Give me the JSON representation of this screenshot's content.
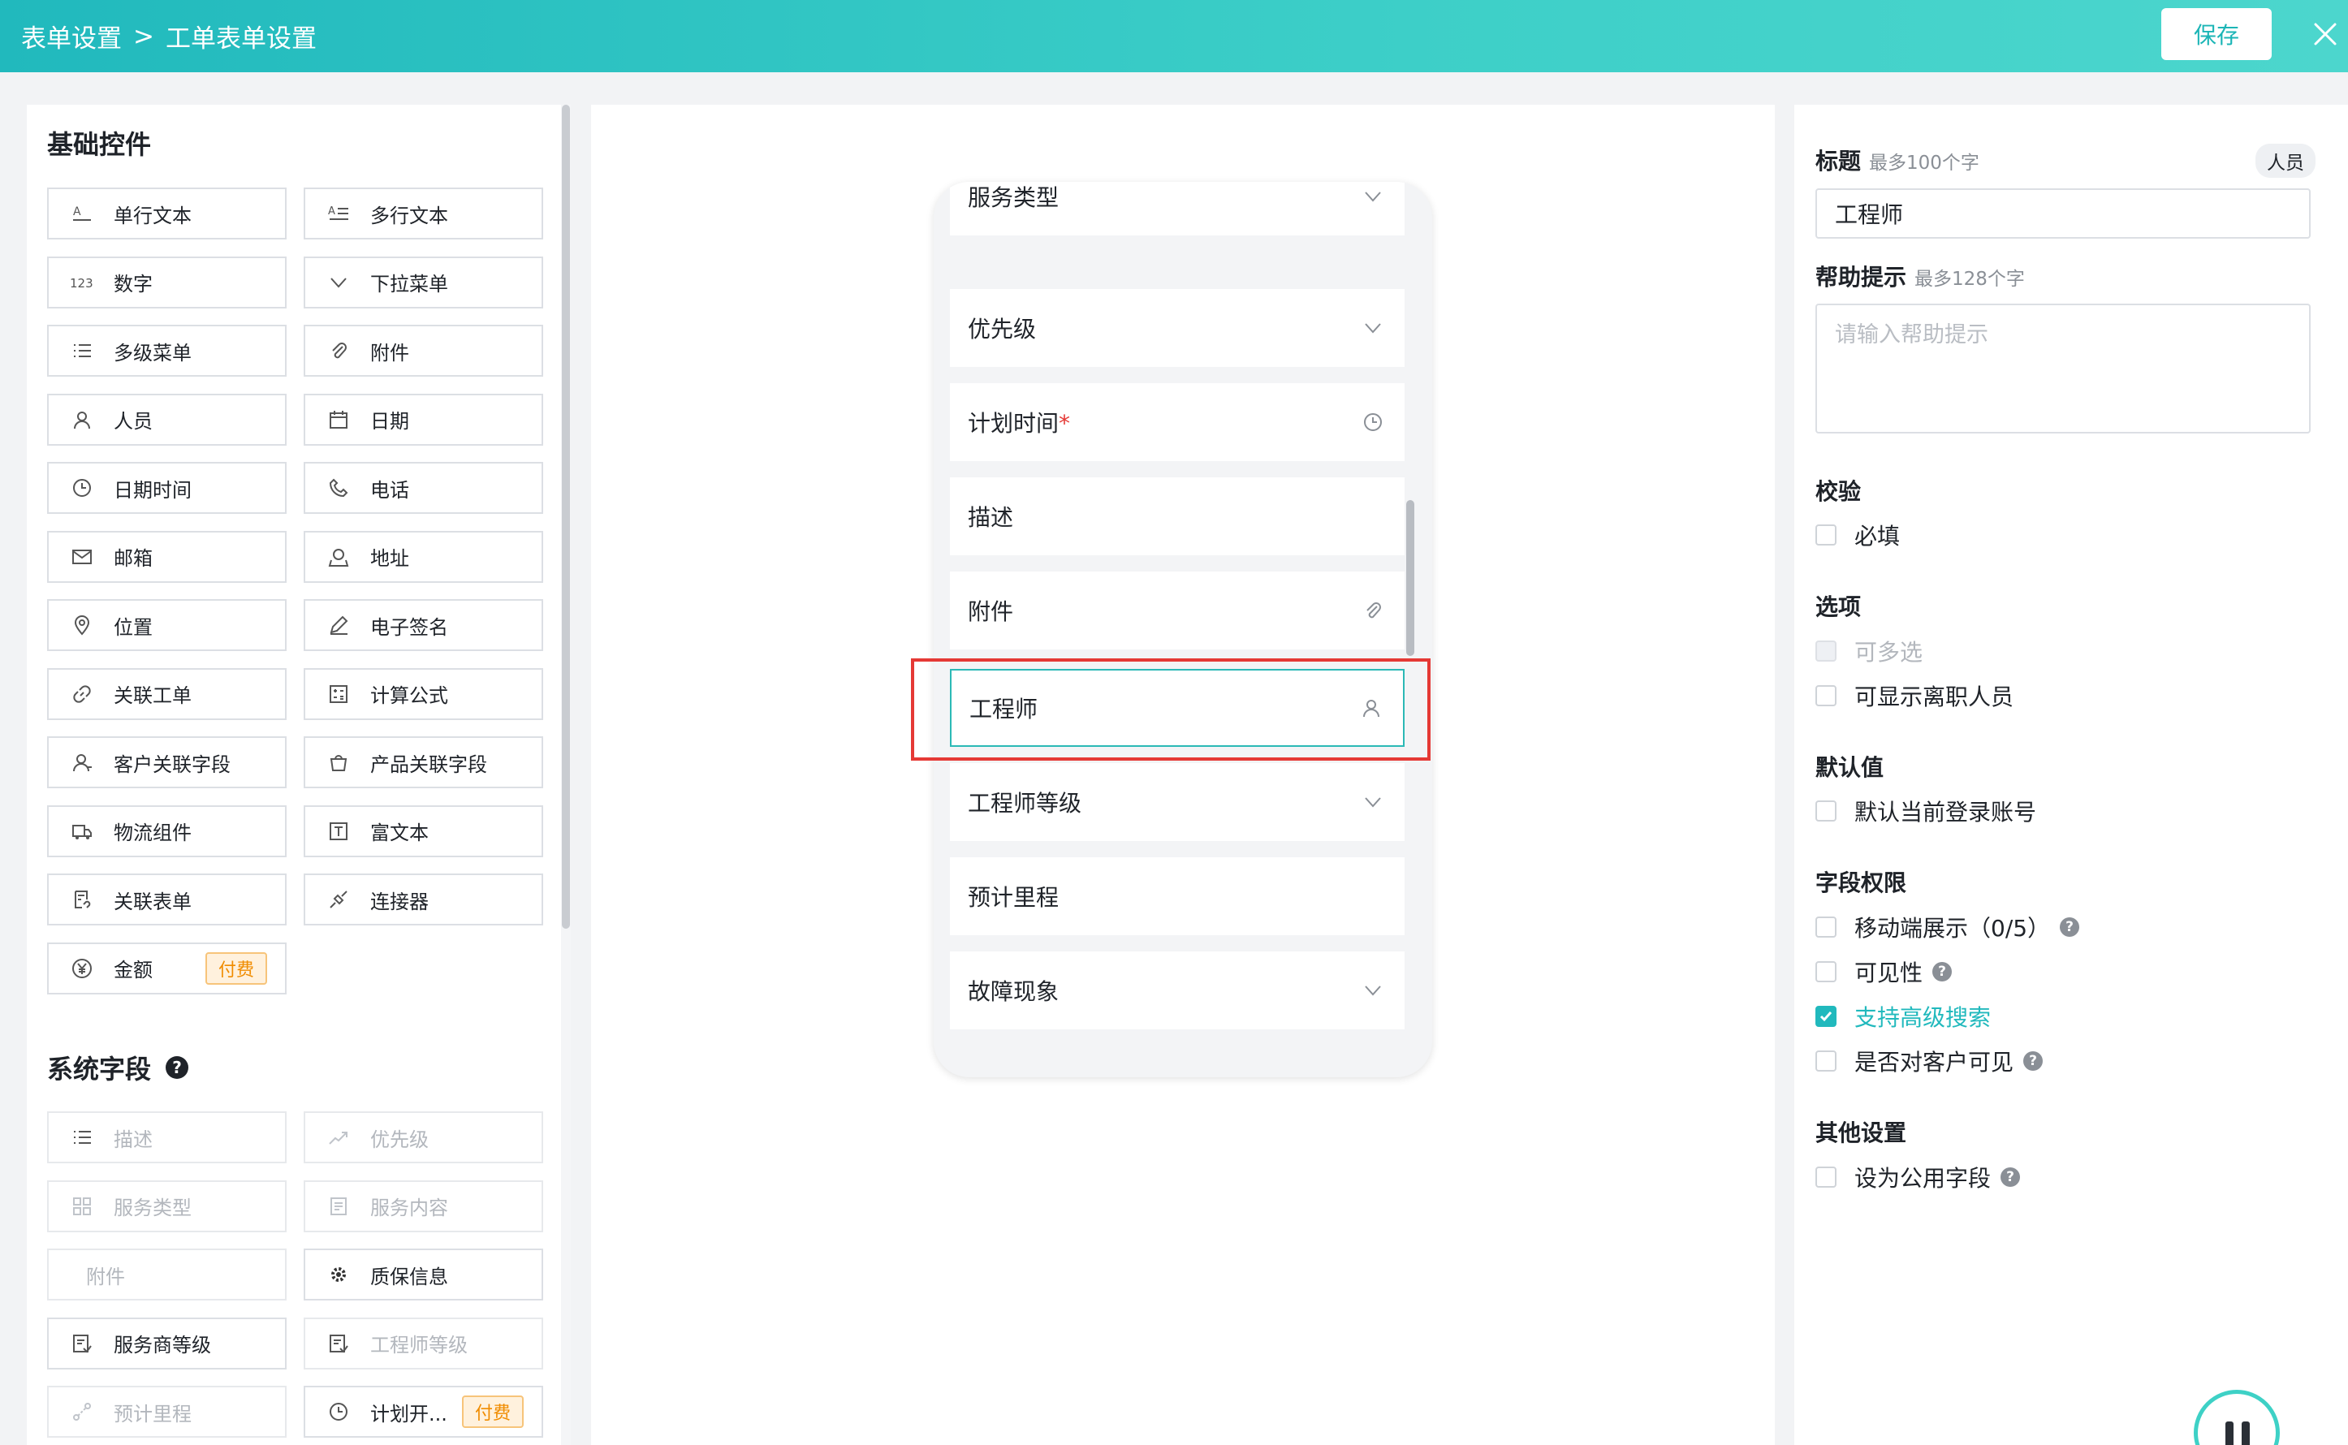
{
  "header": {
    "crumb_root": "表单设置",
    "crumb_sep": ">",
    "crumb_current": "工单表单设置",
    "save_label": "保存"
  },
  "left": {
    "basic_title": "基础控件",
    "basic_controls": [
      {
        "label": "单行文本",
        "icon": "single-line-text-icon"
      },
      {
        "label": "多行文本",
        "icon": "multi-line-text-icon"
      },
      {
        "label": "数字",
        "icon": "number-icon"
      },
      {
        "label": "下拉菜单",
        "icon": "chevron-down-icon"
      },
      {
        "label": "多级菜单",
        "icon": "list-icon"
      },
      {
        "label": "附件",
        "icon": "paperclip-icon"
      },
      {
        "label": "人员",
        "icon": "user-icon"
      },
      {
        "label": "日期",
        "icon": "calendar-icon"
      },
      {
        "label": "日期时间",
        "icon": "clock-icon"
      },
      {
        "label": "电话",
        "icon": "phone-icon"
      },
      {
        "label": "邮箱",
        "icon": "mail-icon"
      },
      {
        "label": "地址",
        "icon": "map-icon"
      },
      {
        "label": "位置",
        "icon": "location-icon"
      },
      {
        "label": "电子签名",
        "icon": "pen-icon"
      },
      {
        "label": "关联工单",
        "icon": "link-icon"
      },
      {
        "label": "计算公式",
        "icon": "calculator-icon"
      },
      {
        "label": "客户关联字段",
        "icon": "customer-icon"
      },
      {
        "label": "产品关联字段",
        "icon": "product-icon"
      },
      {
        "label": "物流组件",
        "icon": "truck-icon"
      },
      {
        "label": "富文本",
        "icon": "rich-text-icon"
      },
      {
        "label": "关联表单",
        "icon": "form-link-icon"
      },
      {
        "label": "连接器",
        "icon": "connector-icon"
      },
      {
        "label": "金额",
        "icon": "yen-icon",
        "paid": "付费"
      }
    ],
    "system_title": "系统字段",
    "system_help": "?",
    "system_fields": [
      {
        "label": "描述",
        "icon": "list-icon",
        "disabled": true
      },
      {
        "label": "优先级",
        "icon": "trend-icon",
        "disabled": true
      },
      {
        "label": "服务类型",
        "icon": "grid-icon",
        "disabled": true
      },
      {
        "label": "服务内容",
        "icon": "document-icon",
        "disabled": true
      },
      {
        "label": "附件",
        "icon": "",
        "disabled": true
      },
      {
        "label": "质保信息",
        "icon": "gear-icon",
        "disabled": false
      },
      {
        "label": "服务商等级",
        "icon": "level-icon",
        "disabled": false
      },
      {
        "label": "工程师等级",
        "icon": "level-icon",
        "disabled": true
      },
      {
        "label": "预计里程",
        "icon": "route-icon",
        "disabled": true
      },
      {
        "label": "计划开...",
        "icon": "clock-icon",
        "disabled": false,
        "paid": "付费"
      }
    ]
  },
  "phone": {
    "fields": [
      {
        "label": "服务类型",
        "icon": "chevron-down-icon"
      },
      {
        "label": "优先级",
        "icon": "chevron-down-icon"
      },
      {
        "label": "计划时间",
        "required": "*",
        "icon": "clock-icon"
      },
      {
        "label": "描述",
        "icon": ""
      },
      {
        "label": "附件",
        "icon": "paperclip-icon"
      },
      {
        "label": "工程师",
        "icon": "user-icon",
        "active": true
      },
      {
        "label": "工程师等级",
        "icon": "chevron-down-icon"
      },
      {
        "label": "预计里程",
        "icon": ""
      },
      {
        "label": "故障现象",
        "icon": "chevron-down-icon"
      }
    ]
  },
  "right": {
    "title_label": "标题",
    "title_hint": "最多100个字",
    "type_tag": "人员",
    "title_value": "工程师",
    "help_label": "帮助提示",
    "help_hint": "最多128个字",
    "help_placeholder": "请输入帮助提示",
    "validate_label": "校验",
    "required_label": "必填",
    "options_label": "选项",
    "multi_label": "可多选",
    "resigned_label": "可显示离职人员",
    "default_label": "默认值",
    "default_current_label": "默认当前登录账号",
    "permission_label": "字段权限",
    "mobile_display_label": "移动端展示（0/5）",
    "visibility_label": "可见性",
    "advanced_search_label": "支持高级搜索",
    "customer_visible_label": "是否对客户可见",
    "other_label": "其他设置",
    "public_field_label": "设为公用字段"
  },
  "colors": {
    "accent": "#21b9bd",
    "highlight": "#e53935",
    "paid": "#f08c00"
  }
}
